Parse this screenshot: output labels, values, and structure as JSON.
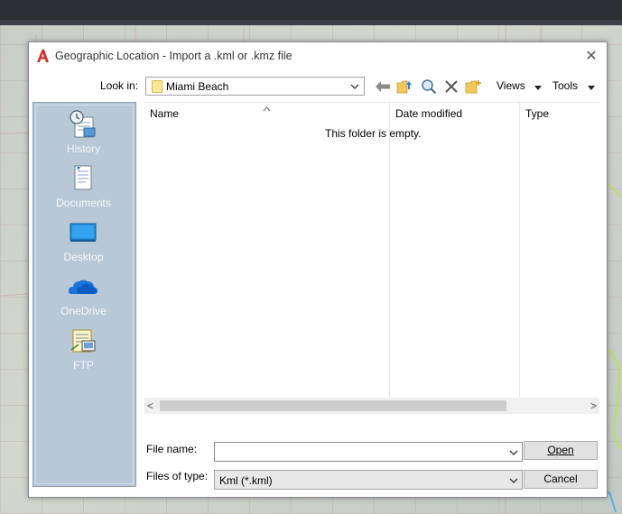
{
  "dialog": {
    "title": "Geographic Location - Import a .kml or .kmz file",
    "close_glyph": "✕"
  },
  "toolbar": {
    "look_in_label": "Look in:",
    "look_in_value": "Miami Beach",
    "icons": [
      "back-arrow-icon",
      "up-folder-icon",
      "search-web-icon",
      "delete-icon",
      "new-folder-icon"
    ],
    "views_label": "Views",
    "tools_label": "Tools"
  },
  "places": [
    {
      "label": "History",
      "icon": "history-icon"
    },
    {
      "label": "Documents",
      "icon": "documents-icon"
    },
    {
      "label": "Desktop",
      "icon": "desktop-icon"
    },
    {
      "label": "OneDrive",
      "icon": "onedrive-icon"
    },
    {
      "label": "FTP",
      "icon": "ftp-icon"
    }
  ],
  "file_list": {
    "columns": [
      "Name",
      "Date modified",
      "Type"
    ],
    "empty_message": "This folder is empty.",
    "scroll_left": "<",
    "scroll_right": ">"
  },
  "form": {
    "file_name_label": "File name:",
    "file_name_value": "",
    "files_of_type_label": "Files of type:",
    "files_of_type_value": "Kml (*.kml)",
    "open_label": "Open",
    "cancel_label": "Cancel"
  },
  "colors": {
    "places_bg": "#b8c8d6",
    "logo_red": "#d32f2f",
    "folder_yellow": "#ffe79a"
  }
}
